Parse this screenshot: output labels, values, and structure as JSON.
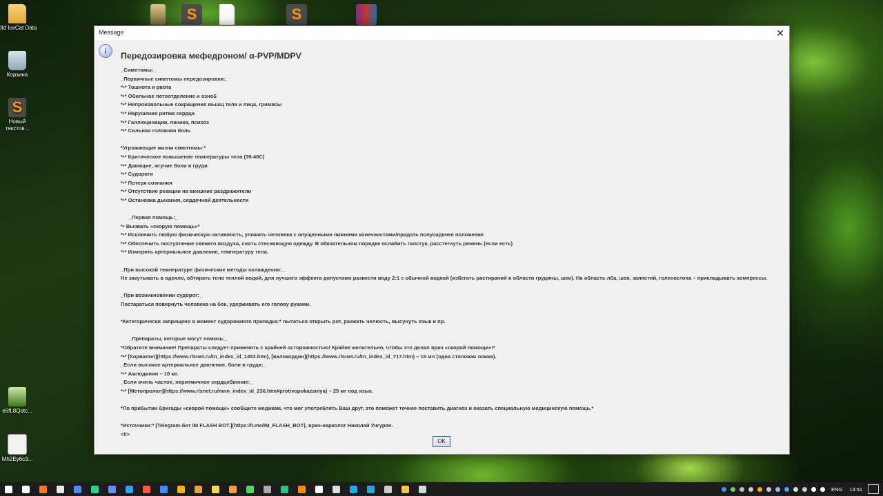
{
  "desktop": {
    "icons": [
      {
        "label": "Old IceCat Data"
      },
      {
        "label": "Корзина"
      },
      {
        "label": "Новый текстов..."
      },
      {
        "label": "e6fL8Qotc..."
      },
      {
        "label": "Mh2Ey6c3..."
      }
    ]
  },
  "dialog": {
    "title": "Message",
    "close": "✕",
    "info_glyph": "i",
    "heading": "Передозировка мефедроном/ α-PVP/MDPV",
    "lines": [
      {
        "text": "_Симптомы:_",
        "style": "normal"
      },
      {
        "text": "_Первичные симптомы передозировки:_",
        "style": "normal"
      },
      {
        "text": "*•* Тошнота и рвота",
        "style": "normal"
      },
      {
        "text": "*•* Обильное потоотделение и озноб",
        "style": "normal"
      },
      {
        "text": "*•* Непроизвольные сокращения мышц тела и лица, гримасы",
        "style": "normal"
      },
      {
        "text": "*•* Нарушения ритма сердца",
        "style": "normal"
      },
      {
        "text": "*•* Галлюцинации, паника, психоз",
        "style": "normal"
      },
      {
        "text": "*•* Сильная головная боль",
        "style": "normal"
      },
      {
        "text": "",
        "style": "blank"
      },
      {
        "text": "*Угрожающие жизни симптомы:*",
        "style": "normal"
      },
      {
        "text": "*•* Критическое повышение температуры тела (39-40С)",
        "style": "normal"
      },
      {
        "text": "*•* Давящие, жгучие боли в груди",
        "style": "normal"
      },
      {
        "text": "*•* Судороги",
        "style": "normal"
      },
      {
        "text": "*•* Потеря сознания",
        "style": "normal"
      },
      {
        "text": "*•* Отсутствие реакции на внешние раздражители",
        "style": "normal"
      },
      {
        "text": "*•* Остановка дыхания, сердечной деятельности",
        "style": "normal"
      },
      {
        "text": "",
        "style": "blank"
      },
      {
        "text": "_Первая помощь:_",
        "style": "indent"
      },
      {
        "text": "*• Вызвать «скорую помощь»*",
        "style": "normal"
      },
      {
        "text": "*•* Исключить любую физическую активность, уложить человека с опущенными нижними конечностями/придать полусидячее положение",
        "style": "normal"
      },
      {
        "text": "*•* Обеспечить поступление свежего воздуха, снять стесняющую одежду. В обязательном порядке ослабить галстук, расстегнуть ремень (если есть)",
        "style": "normal"
      },
      {
        "text": "*•* Измерить артериальное давление, температуру тела.",
        "style": "normal"
      },
      {
        "text": "",
        "style": "blank"
      },
      {
        "text": "_При высокой температуре физические методы охлаждения:_",
        "style": "normal"
      },
      {
        "text": "Не закутывать в одеяло, обтирать тело теплой водой, для лучшего эффекта допустимо развести воду 2:1 с обычной водкой (избегать растираний в области грудины, шеи). На область лба, шеи, запястий, голеностопа – прикладывать компрессы.",
        "style": "normal"
      },
      {
        "text": "",
        "style": "blank"
      },
      {
        "text": "_При возникновении судорог:_",
        "style": "normal"
      },
      {
        "text": "Постараться повернуть человека на бок, удерживать его голову руками.",
        "style": "normal"
      },
      {
        "text": "",
        "style": "blank"
      },
      {
        "text": "*Категорически запрещено в момент судорожного припадка:* пытаться открыть рот, разжать челюсть, высунуть язык и пр.",
        "style": "normal"
      },
      {
        "text": "",
        "style": "blank"
      },
      {
        "text": "_Препараты, которые могут помочь:_",
        "style": "indent"
      },
      {
        "text": "*Обратите внимание! Препараты следует применять с крайней осторожностью! Крайне желательно, чтобы это делал врач «скорой помощи»!*",
        "style": "normal"
      },
      {
        "text": "*•* [Корвалол](https://www.rlsnet.ru/tn_index_id_1453.htm), [валокордин](https://www.rlsnet.ru/tn_index_id_717.htm) – 15 мл (одна столовая ложка).",
        "style": "normal"
      },
      {
        "text": "_Если высокое артериальное давление, боли в груди:_",
        "style": "normal"
      },
      {
        "text": "*•* Амлодипин – 10 мг.",
        "style": "normal"
      },
      {
        "text": "_Если очень частое, неритмичное сердцебиение:_",
        "style": "normal"
      },
      {
        "text": "*•* [Метопролол](https://www.rlsnet.ru/mnn_index_id_236.htm#protivopokazaniya) – 25 мг под язык.",
        "style": "normal"
      },
      {
        "text": "",
        "style": "blank"
      },
      {
        "text": "*По прибытии бригады «скорой помощи» сообщите медикам, что мог употреблять Ваш друг, это поможет точнее поставить диагноз и оказать специальную медицинскую помощь.*",
        "style": "normal"
      },
      {
        "text": "",
        "style": "blank"
      },
      {
        "text": "*Источники:* [Telegram-бот IM FLASH BOT.](https://t.me/IM_FLASH_BOT), врач-нарколог Николай Унгурян.",
        "style": "normal"
      },
      {
        "text": "</i>",
        "style": "normal"
      }
    ],
    "ok_label": "OK"
  },
  "taskbar": {
    "lang": "ENG",
    "time": "13:51",
    "apps": [
      {
        "name": "start-button",
        "color": "#ffffff"
      },
      {
        "name": "task-view-button",
        "color": "#ffffff"
      },
      {
        "name": "firefox-app",
        "color": "#ff7a1a"
      },
      {
        "name": "store-app",
        "color": "#e8e8e8"
      },
      {
        "name": "terminal-app",
        "color": "#4a8cff"
      },
      {
        "name": "pycharm-app",
        "color": "#21d789"
      },
      {
        "name": "notes-app",
        "color": "#6a8cff"
      },
      {
        "name": "edge-app",
        "color": "#2ea3f2"
      },
      {
        "name": "firefox-dev-app",
        "color": "#ff5a3a"
      },
      {
        "name": "globe-app",
        "color": "#3b8cff"
      },
      {
        "name": "chrome-app",
        "color": "#f4b400"
      },
      {
        "name": "torrent-app",
        "color": "#e6a23c"
      },
      {
        "name": "pen-app",
        "color": "#f9d84a"
      },
      {
        "name": "brush-app",
        "color": "#f0a040"
      },
      {
        "name": "download-app",
        "color": "#4cd964"
      },
      {
        "name": "tools-app",
        "color": "#aaaaaa"
      },
      {
        "name": "steam-app",
        "color": "#2ec27e"
      },
      {
        "name": "audio-app",
        "color": "#ff8a00"
      },
      {
        "name": "grid-app",
        "color": "#ffffff"
      },
      {
        "name": "game-app",
        "color": "#dddddd"
      },
      {
        "name": "vscode-app",
        "color": "#23a9f2"
      },
      {
        "name": "telegram-app",
        "color": "#2aa3e0"
      },
      {
        "name": "media-app",
        "color": "#cccccc"
      },
      {
        "name": "explorer-app",
        "color": "#f5c542"
      },
      {
        "name": "java-app",
        "color": "#d0d8e0"
      }
    ],
    "tray": [
      {
        "name": "telegram-tray-icon",
        "color": "#2aa3e0"
      },
      {
        "name": "shield-tray-icon",
        "color": "#5fd35f"
      },
      {
        "name": "monitor-tray-icon",
        "color": "#bbbbbb"
      },
      {
        "name": "circle-tray-icon",
        "color": "#cccccc"
      },
      {
        "name": "chrome-tray-icon",
        "color": "#f4b400"
      },
      {
        "name": "gear-tray-icon",
        "color": "#cccccc"
      },
      {
        "name": "steam-tray-icon",
        "color": "#8ec0ff"
      },
      {
        "name": "bluetooth-tray-icon",
        "color": "#4aa3ff"
      },
      {
        "name": "flag-tray-icon",
        "color": "#dddddd"
      },
      {
        "name": "usb-tray-icon",
        "color": "#cccccc"
      },
      {
        "name": "wifi-tray-icon",
        "color": "#ffffff"
      },
      {
        "name": "volume-tray-icon",
        "color": "#ffffff"
      }
    ]
  }
}
